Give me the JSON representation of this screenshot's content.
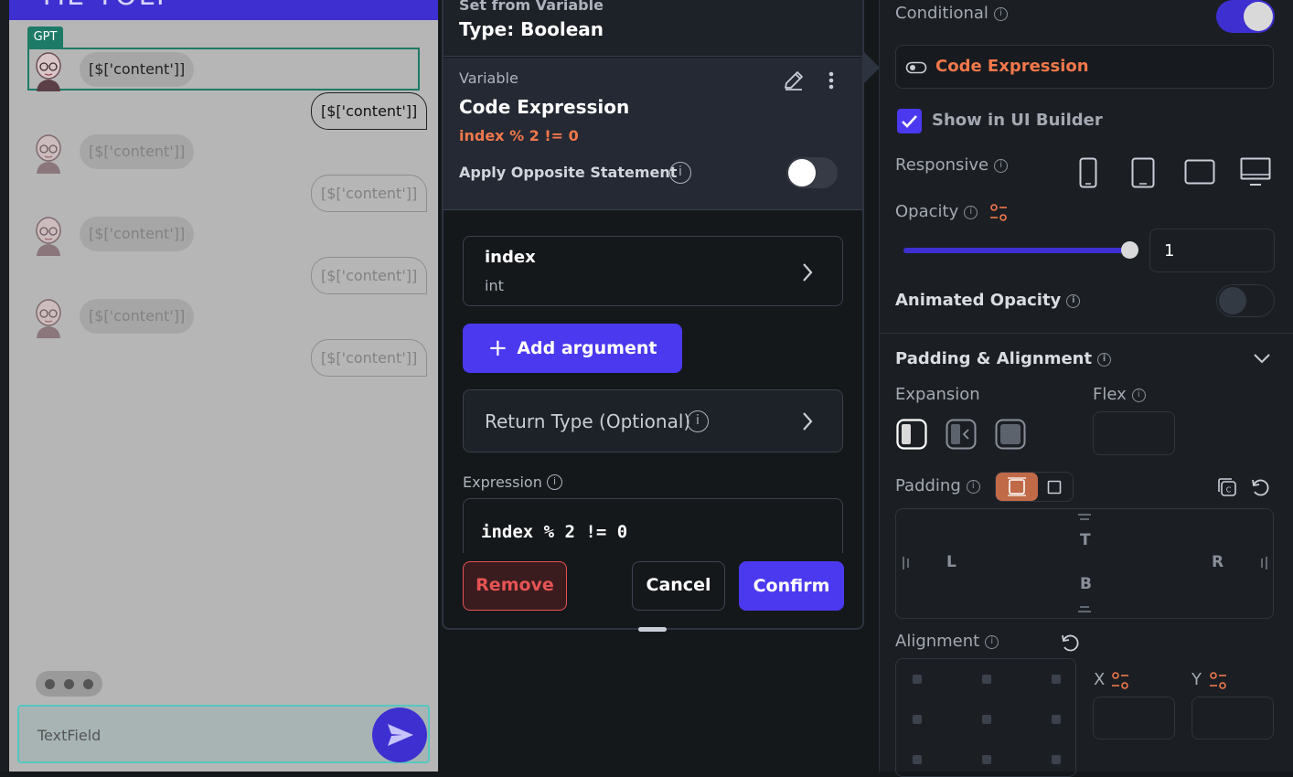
{
  "preview": {
    "app_title": "TIE TOLT",
    "gpt_tag": "GPT",
    "messages": [
      {
        "side": "left",
        "text": "[$['content']]"
      },
      {
        "side": "right",
        "text": "[$['content']]"
      },
      {
        "side": "left",
        "text": "[$['content']]"
      },
      {
        "side": "right",
        "text": "[$['content']]"
      },
      {
        "side": "left",
        "text": "[$['content']]"
      },
      {
        "side": "right",
        "text": "[$['content']]"
      },
      {
        "side": "left",
        "text": "[$['content']]"
      },
      {
        "side": "right",
        "text": "[$['content']]"
      }
    ],
    "textfield_label": "TextField"
  },
  "dialog": {
    "source_label": "Set from Variable",
    "type_label": "Type: Boolean",
    "variable_label": "Variable",
    "variable_name": "Code Expression",
    "expression_summary": "index % 2 != 0",
    "apply_opposite_label": "Apply Opposite Statement",
    "apply_opposite_on": false,
    "argument": {
      "name": "index",
      "type": "int"
    },
    "add_argument_label": "Add argument",
    "return_type_label": "Return Type (Optional)",
    "expression_label": "Expression",
    "expression_code": "index % 2 != 0",
    "remove_label": "Remove",
    "cancel_label": "Cancel",
    "confirm_label": "Confirm"
  },
  "properties": {
    "conditional_label": "Conditional",
    "conditional_on": true,
    "conditional_value": "Code Expression",
    "show_in_builder_label": "Show in UI Builder",
    "show_in_builder_checked": true,
    "responsive_label": "Responsive",
    "responsive_devices": [
      "phone-icon",
      "tablet-icon",
      "tablet-landscape-icon",
      "desktop-icon"
    ],
    "opacity_label": "Opacity",
    "opacity_value": "1",
    "opacity_level": 1,
    "animated_opacity_label": "Animated Opacity",
    "animated_opacity_on": false,
    "padding_alignment_header": "Padding & Alignment",
    "expansion_label": "Expansion",
    "flex_label": "Flex",
    "padding_label": "Padding",
    "padding_sides": {
      "top": "T",
      "left": "L",
      "right": "R",
      "bottom": "B"
    },
    "alignment_label": "Alignment",
    "align_x_label": "X",
    "align_y_label": "Y"
  },
  "colors": {
    "accent": "#3d2fd0",
    "button_primary": "#4b39ef",
    "orange": "#f2784b",
    "danger": "#e55353",
    "teal": "#1d7a66"
  }
}
